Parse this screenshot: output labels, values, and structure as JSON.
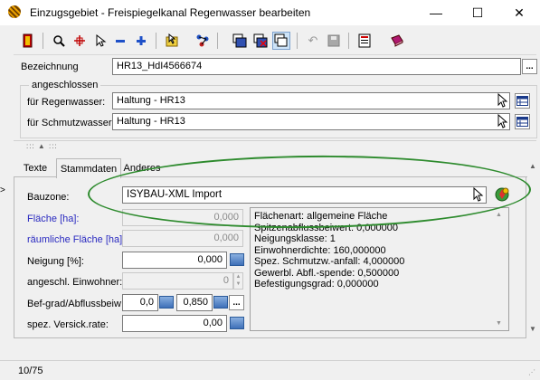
{
  "window": {
    "title": "Einzugsgebiet - Freispiegelkanal Regenwasser bearbeiten"
  },
  "window_controls": {
    "minimize": "—",
    "maximize": "☐",
    "close": "✕"
  },
  "toolbar": {
    "icons": [
      "exit-door-icon",
      "search-icon",
      "crosshair-icon",
      "pointer-icon",
      "minus-icon",
      "plus-icon",
      "select-tool-icon",
      "network-icon",
      "windows-icon",
      "windows-close-icon",
      "windows-stack-icon",
      "undo-icon",
      "save-icon",
      "report-icon",
      "book-icon"
    ]
  },
  "bezeichnung": {
    "label": "Bezeichnung",
    "value": "HR13_HdI4566674",
    "ellipsis": "..."
  },
  "angeschlossen": {
    "legend": "angeschlossen",
    "regen": {
      "label": "für Regenwasser:",
      "value": "Haltung - HR13"
    },
    "schmutz": {
      "label": "für Schmutzwasser:",
      "value": "Haltung - HR13"
    }
  },
  "splitter": {
    "glyph": "::: ▲ :::"
  },
  "tabs": [
    {
      "label": "Texte"
    },
    {
      "label": "Stammdaten"
    },
    {
      "label": "Anderes"
    }
  ],
  "bauzone": {
    "label": "Bauzone:",
    "value": "ISYBAU-XML Import"
  },
  "fields": {
    "flaeche": {
      "label": "Fläche [ha]:",
      "value": "0,000"
    },
    "raeumliche_flaeche": {
      "label": "räumliche Fläche [ha]:",
      "value": "0,000"
    },
    "neigung": {
      "label": "Neigung [%]:",
      "value": "0,000"
    },
    "einwohner": {
      "label": "angeschl. Einwohner:",
      "value": "0"
    },
    "befgrad": {
      "label": "Bef-grad/Abflussbeiw:",
      "value1": "0,0",
      "value2": "0,850",
      "ellipsis": "..."
    },
    "versick": {
      "label": "spez. Versick.rate:",
      "value": "0,00"
    }
  },
  "info_lines": [
    "Flächenart: allgemeine Fläche",
    "Spitzenabflussbeiwert: 0,000000",
    "Neigungsklasse: 1",
    "Einwohnerdichte: 160,000000",
    "Spez. Schmutzw.-anfall: 4,000000",
    "Gewerbl. Abfl.-spende: 0,500000",
    "Befestigungsgrad: 0,000000"
  ],
  "status": {
    "record": "10/75"
  },
  "colors": {
    "annotation": "#2e8b2e",
    "label_blue": "#2a2ac0"
  }
}
